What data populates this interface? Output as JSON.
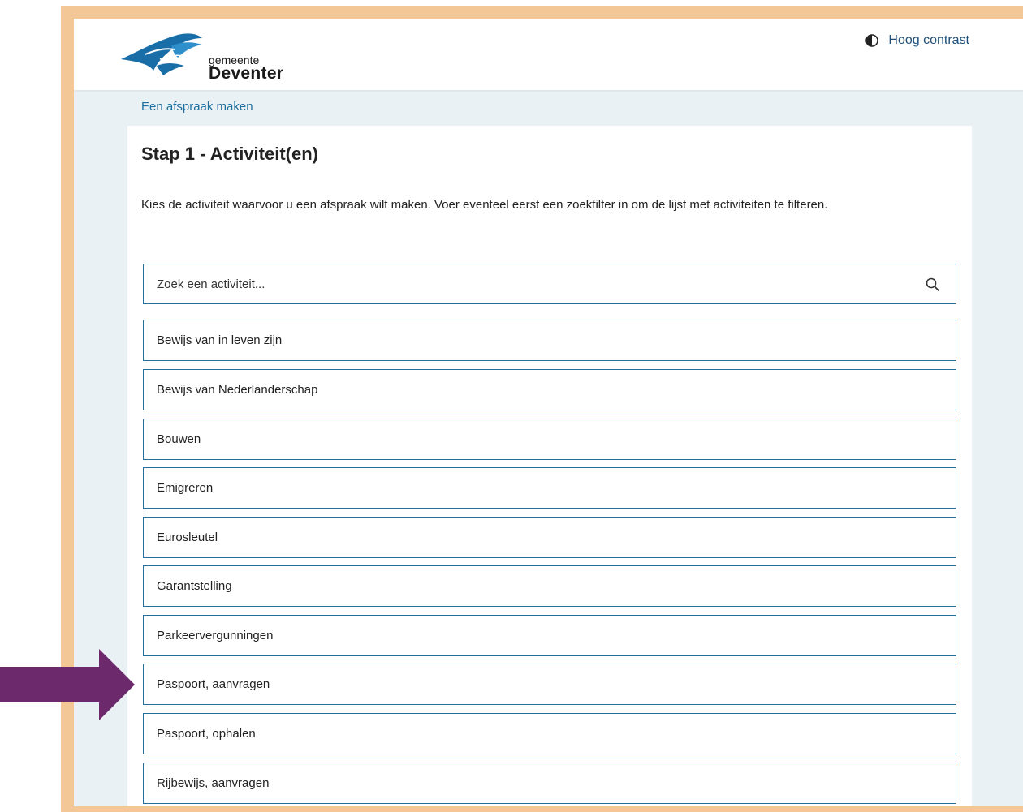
{
  "header": {
    "logo_sub": "gemeente",
    "logo_main": "Deventer",
    "contrast_label": "Hoog contrast"
  },
  "breadcrumb": "Een afspraak maken",
  "page": {
    "title": "Stap 1 - Activiteit(en)",
    "intro": "Kies de activiteit waarvoor u een afspraak wilt maken. Voer eventeel eerst een zoekfilter in om de lijst met activiteiten te filteren."
  },
  "search": {
    "placeholder": "Zoek een activiteit...",
    "value": ""
  },
  "activities": [
    {
      "label": "Bewijs van in leven zijn"
    },
    {
      "label": "Bewijs van Nederlanderschap"
    },
    {
      "label": "Bouwen"
    },
    {
      "label": "Emigreren"
    },
    {
      "label": "Eurosleutel"
    },
    {
      "label": "Garantstelling"
    },
    {
      "label": "Parkeervergunningen"
    },
    {
      "label": "Paspoort, aanvragen"
    },
    {
      "label": "Paspoort, ophalen"
    },
    {
      "label": "Rijbewijs, aanvragen"
    }
  ],
  "highlighted_activity": "Paspoort, aanvragen",
  "colors": {
    "frame": "#f4c896",
    "page_background": "#eaf1f5",
    "link": "#1d6fa0",
    "border": "#236f9a",
    "logo_blue": "#1a6ea8",
    "arrow": "#6c2a6c"
  },
  "icons": {
    "search": "magnifier-icon",
    "contrast": "half-filled-circle-icon",
    "annotation": "right-arrow-icon"
  }
}
